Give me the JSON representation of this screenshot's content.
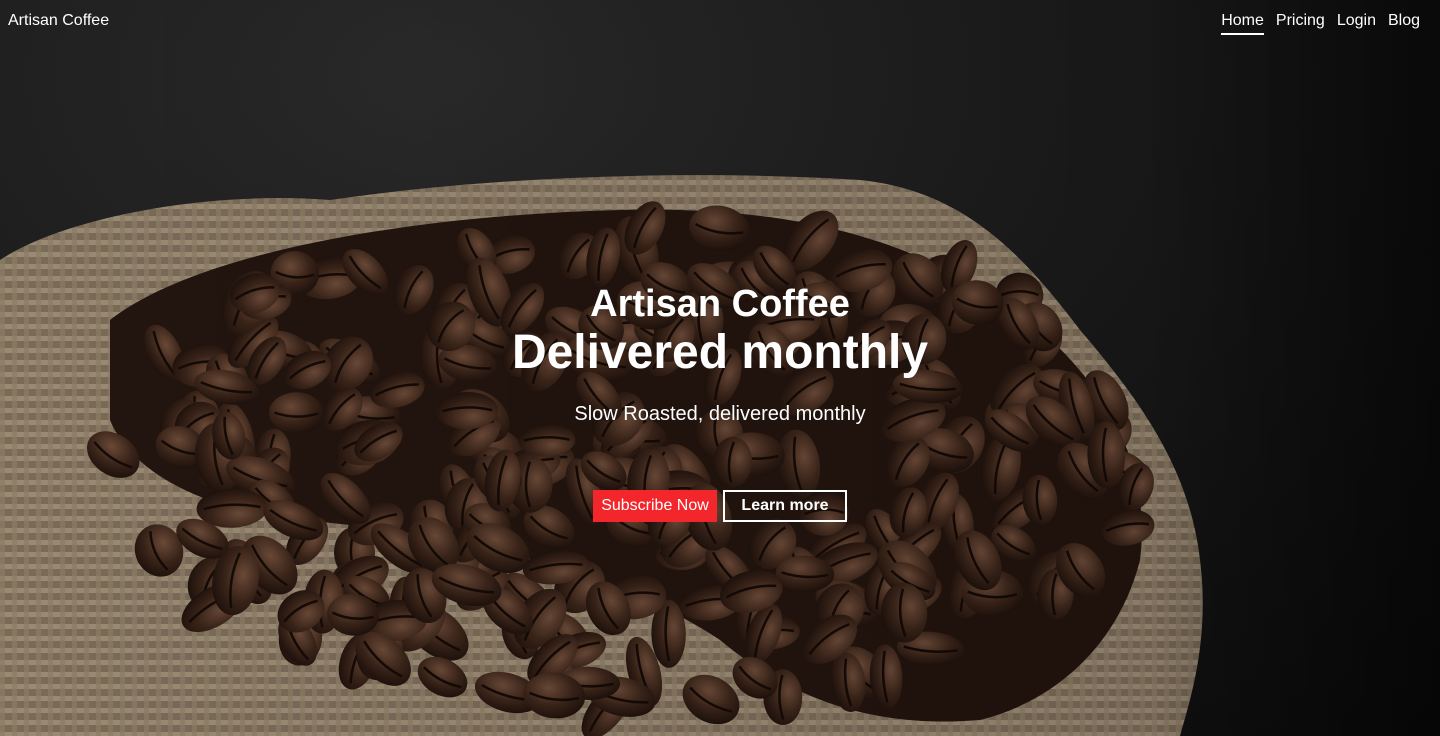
{
  "nav": {
    "brand": "Artisan Coffee",
    "links": [
      {
        "label": "Home",
        "active": true
      },
      {
        "label": "Pricing",
        "active": false
      },
      {
        "label": "Login",
        "active": false
      },
      {
        "label": "Blog",
        "active": false
      }
    ]
  },
  "hero": {
    "title_line1": "Artisan Coffee",
    "title_line2": "Delivered monthly",
    "subtitle": "Slow Roasted, delivered monthly",
    "primary_cta": "Subscribe Now",
    "secondary_cta": "Learn more",
    "background_image": "coffee-beans-burlap-sack"
  },
  "colors": {
    "accent": "#f2262b",
    "text": "#ffffff",
    "background": "#141414"
  }
}
